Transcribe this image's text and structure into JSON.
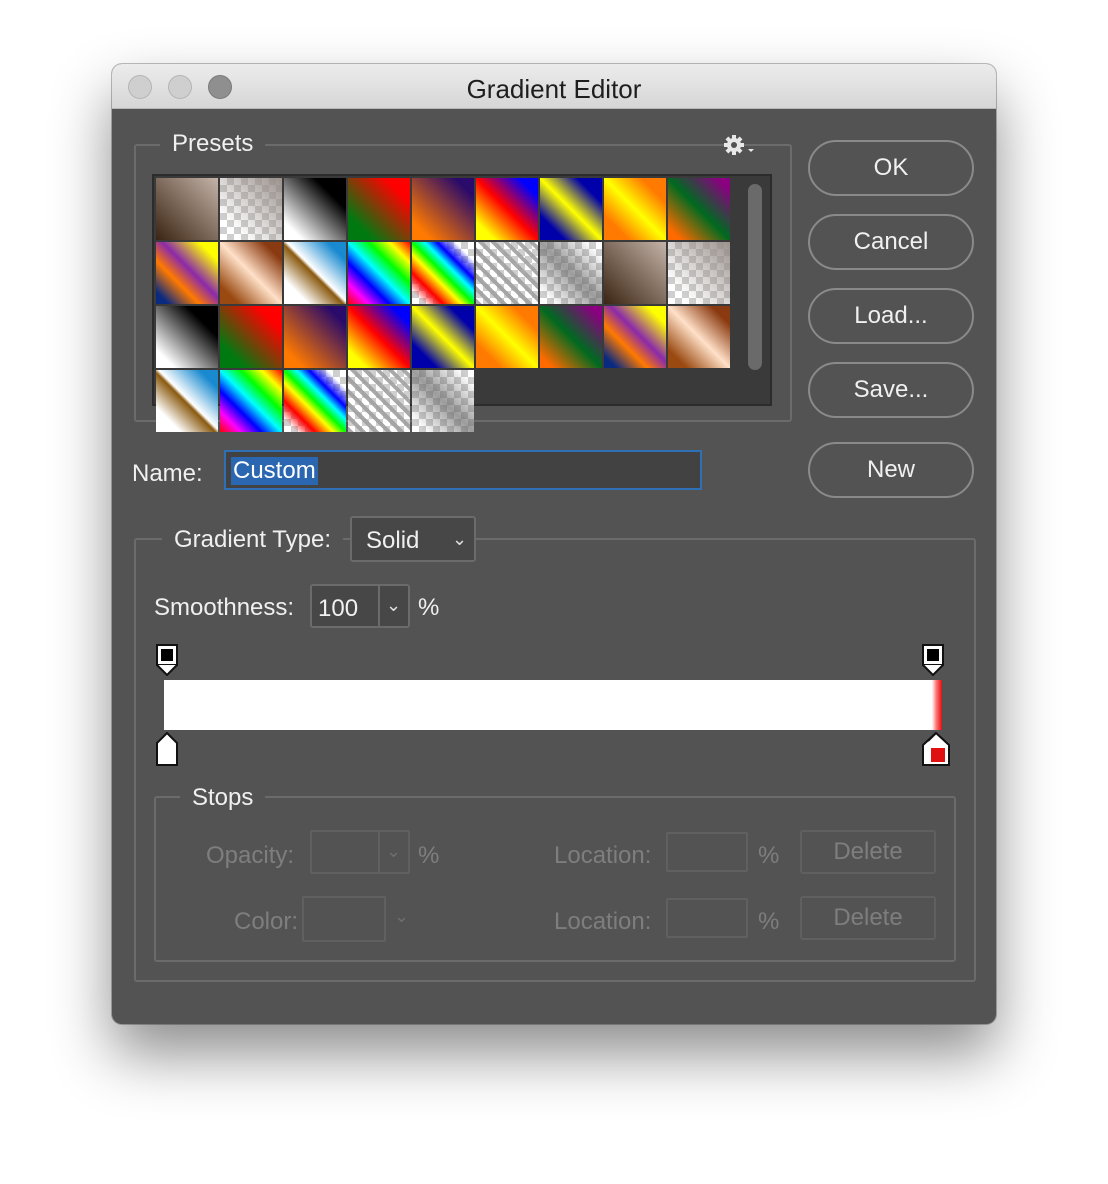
{
  "window": {
    "title": "Gradient Editor"
  },
  "presets": {
    "legend": "Presets",
    "menu_icon": "gear-icon",
    "swatches": [
      {
        "name": "foreground-to-background",
        "bg": "linear-gradient(45deg,#3a2412,#c4b3a8)"
      },
      {
        "name": "foreground-to-transparent",
        "bg": "linear-gradient(45deg,rgba(150,140,135,0) 20%,rgba(150,140,135,0.95))",
        "checker": true
      },
      {
        "name": "black-white",
        "bg": "linear-gradient(45deg,#ffffff 15%,#000000 75%)"
      },
      {
        "name": "red-green",
        "bg": "linear-gradient(45deg,#007a10 20%,#ff0000 80%)"
      },
      {
        "name": "violet-orange",
        "bg": "linear-gradient(45deg,#ff7a00 15%,#2a0a6a 85%)"
      },
      {
        "name": "blue-red-yellow",
        "bg": "linear-gradient(45deg,#ffff00 15%,#ff0000 50%,#0000ff 85%)"
      },
      {
        "name": "blue-yellow-blue",
        "bg": "linear-gradient(45deg,#0000aa 20%,#ffff00 50%,#0000aa 80%)"
      },
      {
        "name": "orange-yellow-orange",
        "bg": "linear-gradient(45deg,#ff7a00 20%,#ffff00 50%,#ff7a00 80%)"
      },
      {
        "name": "violet-green-orange",
        "bg": "linear-gradient(45deg,#ff6a00 10%,#006a20 50%,#8a0080 90%)"
      },
      {
        "name": "yellow-violet-orange-blue",
        "bg": "linear-gradient(45deg,#0a2a80 10%,#ff7a00 35%,#8a2aaa 55%,#ffff00 85%)"
      },
      {
        "name": "copper",
        "bg": "linear-gradient(45deg,#9a4a10 15%,#ffe0c8 50%,#8a3a10 85%)"
      },
      {
        "name": "chrome",
        "bg": "linear-gradient(45deg,#ffffff 20%,#8a5a10 48%,#ffffff 52%,#1a8ad0 85%)"
      },
      {
        "name": "spectrum",
        "bg": "linear-gradient(45deg,#ff0000,#ff00ff,#0000ff,#00ffff,#00ff00,#ffff00,#ff0000)"
      },
      {
        "name": "transparent-rainbow",
        "bg": "linear-gradient(45deg,transparent 10%,#ff0000 25%,#ffff00 40%,#00ff00 50%,#00ffff 60%,#0000ff 70%,transparent 85%)",
        "checker": true
      },
      {
        "name": "transparent-stripes",
        "bg": "repeating-linear-gradient(45deg,rgba(160,160,160,0.9) 0 4px,transparent 4px 9px)",
        "checker": true
      },
      {
        "name": "neutral-density",
        "bg": "linear-gradient(45deg,rgba(120,120,120,0) 10%,rgba(90,90,90,0.6) 50%,rgba(120,120,120,0) 90%)",
        "checker": true
      },
      {
        "name": "foreground-to-background-2",
        "bg": "linear-gradient(45deg,#3a2412,#c4b3a8)"
      },
      {
        "name": "foreground-to-transparent-2",
        "bg": "linear-gradient(45deg,rgba(150,140,135,0) 20%,rgba(150,140,135,0.95))",
        "checker": true
      },
      {
        "name": "black-white-2",
        "bg": "linear-gradient(45deg,#ffffff 15%,#000000 75%)"
      },
      {
        "name": "red-green-2",
        "bg": "linear-gradient(45deg,#007a10 20%,#ff0000 80%)"
      },
      {
        "name": "violet-orange-2",
        "bg": "linear-gradient(45deg,#ff7a00 15%,#2a0a6a 85%)"
      },
      {
        "name": "blue-red-yellow-2",
        "bg": "linear-gradient(45deg,#ffff00 15%,#ff0000 50%,#0000ff 85%)"
      },
      {
        "name": "blue-yellow-blue-2",
        "bg": "linear-gradient(45deg,#0000aa 20%,#ffff00 50%,#0000aa 80%)"
      },
      {
        "name": "orange-yellow-orange-2",
        "bg": "linear-gradient(45deg,#ff7a00 20%,#ffff00 50%,#ff7a00 80%)"
      },
      {
        "name": "violet-green-orange-2",
        "bg": "linear-gradient(45deg,#ff6a00 10%,#006a20 50%,#8a0080 90%)"
      },
      {
        "name": "yellow-violet-orange-blue-2",
        "bg": "linear-gradient(45deg,#0a2a80 10%,#ff7a00 35%,#8a2aaa 55%,#ffff00 85%)"
      },
      {
        "name": "copper-2",
        "bg": "linear-gradient(45deg,#9a4a10 15%,#ffe0c8 50%,#8a3a10 85%)"
      },
      {
        "name": "chrome-2",
        "bg": "linear-gradient(45deg,#ffffff 20%,#8a5a10 48%,#ffffff 52%,#1a8ad0 85%)"
      },
      {
        "name": "spectrum-2",
        "bg": "linear-gradient(45deg,#ff0000,#ff00ff,#0000ff,#00ffff,#00ff00,#ffff00,#ff0000)"
      },
      {
        "name": "transparent-rainbow-2",
        "bg": "linear-gradient(45deg,transparent 10%,#ff0000 25%,#ffff00 40%,#00ff00 50%,#00ffff 60%,#0000ff 70%,transparent 85%)",
        "checker": true
      },
      {
        "name": "transparent-stripes-2",
        "bg": "repeating-linear-gradient(45deg,rgba(160,160,160,0.9) 0 4px,transparent 4px 9px)",
        "checker": true
      },
      {
        "name": "neutral-density-2",
        "bg": "linear-gradient(45deg,rgba(120,120,120,0) 10%,rgba(90,90,90,0.6) 50%,rgba(120,120,120,0) 90%)",
        "checker": true
      }
    ]
  },
  "buttons": {
    "ok": "OK",
    "cancel": "Cancel",
    "load": "Load...",
    "save": "Save...",
    "new": "New"
  },
  "name": {
    "label": "Name:",
    "value": "Custom"
  },
  "gradient_type": {
    "label": "Gradient Type:",
    "value": "Solid"
  },
  "smoothness": {
    "label": "Smoothness:",
    "value": "100",
    "unit": "%"
  },
  "gradient": {
    "stops": [
      {
        "kind": "opacity",
        "location_pct": 0,
        "color": "#000000"
      },
      {
        "kind": "opacity",
        "location_pct": 100,
        "color": "#000000"
      },
      {
        "kind": "color",
        "location_pct": 0,
        "color": "#ffffff"
      },
      {
        "kind": "color",
        "location_pct": 100,
        "color": "#e01010"
      }
    ]
  },
  "stops": {
    "legend": "Stops",
    "opacity_label": "Opacity:",
    "color_label": "Color:",
    "location_label": "Location:",
    "percent": "%",
    "delete_label": "Delete"
  },
  "colors": {
    "panel": "#535353",
    "accent": "#2b66b0",
    "stop_red": "#e01010"
  }
}
